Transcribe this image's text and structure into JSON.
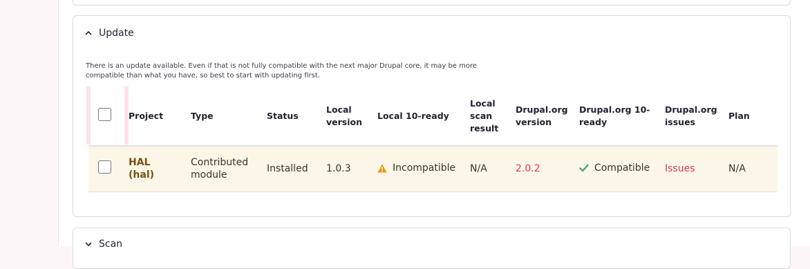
{
  "update_section": {
    "title": "Update",
    "description": "There is an update available. Even if that is not fully compatible with the next major Drupal core, it may be more compatible than what you have, so best to start with updating first.",
    "table": {
      "headers": {
        "project": "Project",
        "type": "Type",
        "status": "Status",
        "local_version": "Local version",
        "local_10_ready": "Local 10-ready",
        "local_scan_result": "Local scan result",
        "drupal_org_version": "Drupal.org version",
        "drupal_org_10_ready": "Drupal.org 10-ready",
        "drupal_org_issues": "Drupal.org issues",
        "plan": "Plan"
      },
      "rows": [
        {
          "project_name": "HAL",
          "project_machine": "(hal)",
          "type": "Contributed module",
          "status": "Installed",
          "local_version": "1.0.3",
          "local_10_ready": "Incompatible",
          "local_scan_result": "N/A",
          "drupal_org_version": "2.0.2",
          "drupal_org_10_ready": "Compatible",
          "drupal_org_issues": "Issues",
          "plan": "N/A"
        }
      ]
    }
  },
  "scan_section": {
    "title": "Scan"
  },
  "colors": {
    "link_red": "#d93561",
    "warning": "#e29700",
    "success": "#42a877",
    "row_highlight": "#fcf6e8",
    "project_link": "#7a4f0c"
  },
  "icons": {
    "update_toggle": "chevron-up-icon",
    "scan_toggle": "chevron-down-icon",
    "incompatible": "warning-triangle-icon",
    "compatible": "checkmark-icon"
  }
}
